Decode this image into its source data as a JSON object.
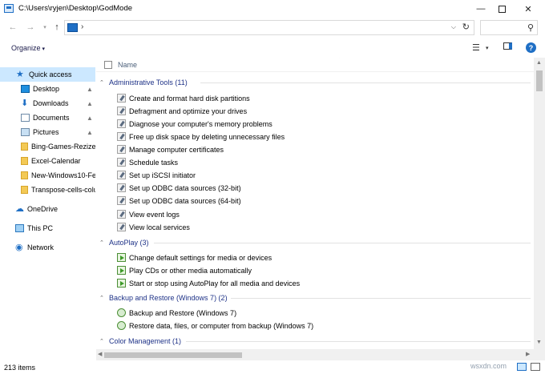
{
  "window": {
    "title": "C:\\Users\\ryjen\\Desktop\\GodMode",
    "minimize_icon": "minimize-icon",
    "maximize_icon": "maximize-icon",
    "close_icon": "close-icon"
  },
  "address_bar": {
    "separator": "›",
    "search_placeholder": ""
  },
  "toolbar": {
    "organize_label": "Organize",
    "organize_caret": "▾"
  },
  "sidebar": {
    "items": [
      {
        "label": "Quick access",
        "icon": "star-icon",
        "pinned": false,
        "selected": true
      },
      {
        "label": "Desktop",
        "icon": "desktop-icon",
        "pinned": true
      },
      {
        "label": "Downloads",
        "icon": "download-icon",
        "pinned": true
      },
      {
        "label": "Documents",
        "icon": "documents-icon",
        "pinned": true
      },
      {
        "label": "Pictures",
        "icon": "pictures-icon",
        "pinned": true
      },
      {
        "label": "Bing-Games-Rezize",
        "icon": "folder-icon",
        "pinned": false
      },
      {
        "label": "Excel-Calendar",
        "icon": "folder-icon",
        "pinned": false
      },
      {
        "label": "New-Windows10-Fe",
        "icon": "folder-icon",
        "pinned": false
      },
      {
        "label": "Transpose-cells-colu",
        "icon": "folder-icon",
        "pinned": false
      },
      {
        "label": "OneDrive",
        "icon": "cloud-icon",
        "pinned": false
      },
      {
        "label": "This PC",
        "icon": "computer-icon",
        "pinned": false
      },
      {
        "label": "Network",
        "icon": "network-icon",
        "pinned": false
      }
    ]
  },
  "list": {
    "column_name": "Name",
    "groups": [
      {
        "label": "Administrative Tools (11)",
        "items": [
          "Create and format hard disk partitions",
          "Defragment and optimize your drives",
          "Diagnose your computer's memory problems",
          "Free up disk space by deleting unnecessary files",
          "Manage computer certificates",
          "Schedule tasks",
          "Set up iSCSI initiator",
          "Set up ODBC data sources (32-bit)",
          "Set up ODBC data sources (64-bit)",
          "View event logs",
          "View local services"
        ]
      },
      {
        "label": "AutoPlay (3)",
        "items": [
          "Change default settings for media or devices",
          "Play CDs or other media automatically",
          "Start or stop using AutoPlay for all media and devices"
        ]
      },
      {
        "label": "Backup and Restore (Windows 7) (2)",
        "items": [
          "Backup and Restore (Windows 7)",
          "Restore data, files, or computer from backup (Windows 7)"
        ]
      },
      {
        "label": "Color Management (1)",
        "items": []
      }
    ]
  },
  "status": {
    "item_count": "213 items"
  },
  "watermark": "wsxdn.com"
}
